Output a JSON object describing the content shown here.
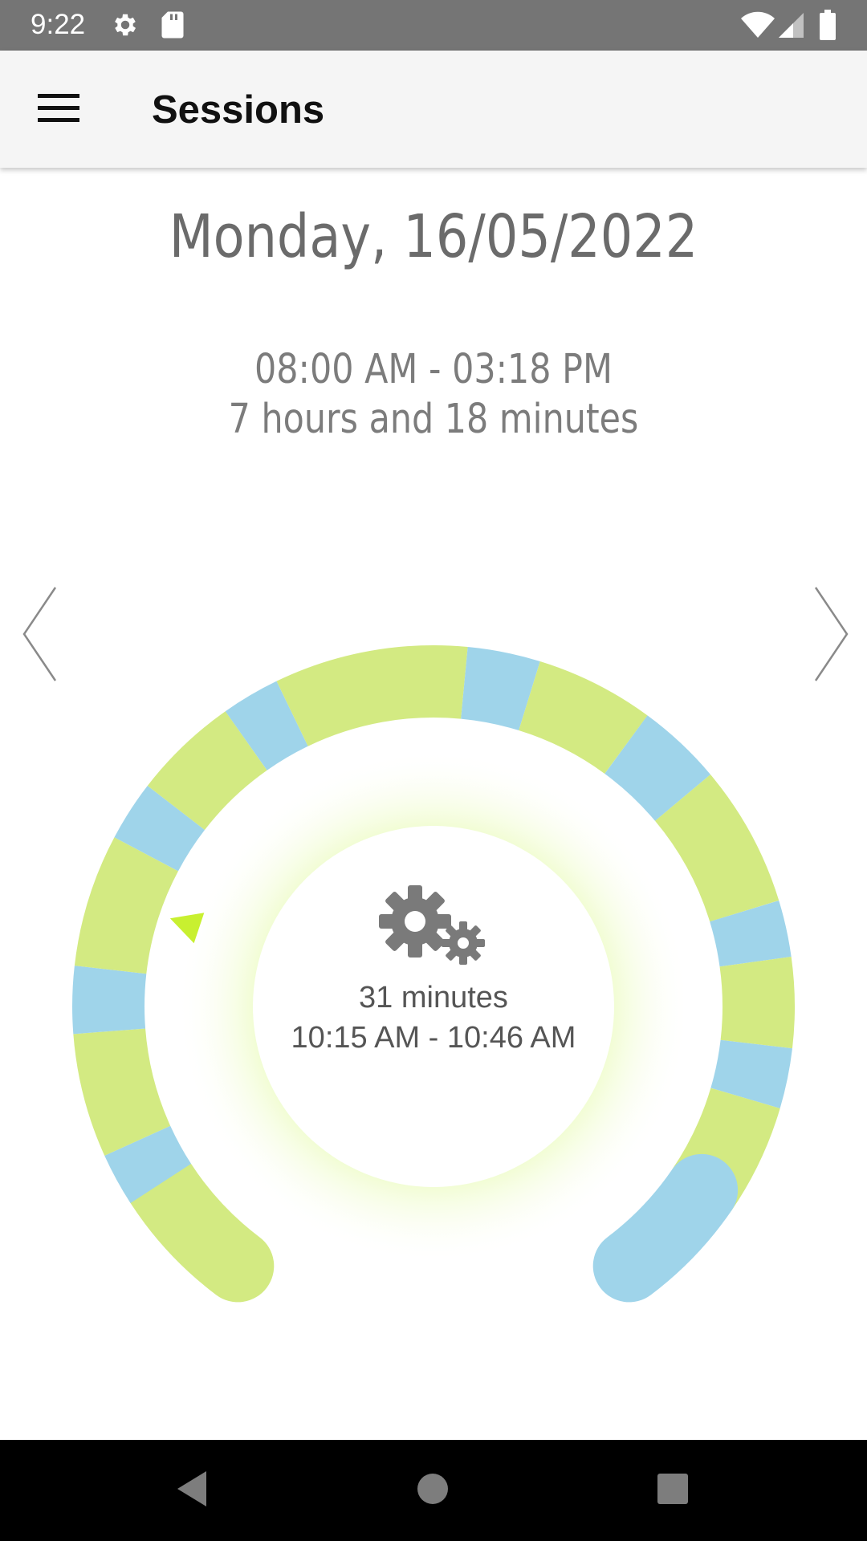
{
  "status_bar": {
    "time": "9:22",
    "icons": [
      "settings-icon",
      "sd-card-icon",
      "wifi-icon",
      "signal-icon",
      "battery-icon"
    ]
  },
  "app_bar": {
    "title": "Sessions",
    "menu_icon": "hamburger-menu-icon"
  },
  "day": {
    "date": "Monday, 16/05/2022",
    "time_range": "08:00 AM - 03:18 PM",
    "total_duration": "7 hours and 18 minutes"
  },
  "selected_session": {
    "icon": "gears-icon",
    "duration": "31 minutes",
    "time_range": "10:15 AM - 10:46 AM"
  },
  "colors": {
    "active": "#d3ea82",
    "break": "#9fd4ea",
    "marker": "#c8f030",
    "glow": "#eefcc8",
    "text": "#6b6b6b"
  },
  "timeline_segments": [
    {
      "type": "active",
      "from": 0.0,
      "to": 0.07
    },
    {
      "type": "break",
      "from": 0.07,
      "to": 0.1
    },
    {
      "type": "active",
      "from": 0.1,
      "to": 0.17
    },
    {
      "type": "break",
      "from": 0.17,
      "to": 0.208
    },
    {
      "type": "active",
      "from": 0.208,
      "to": 0.283
    },
    {
      "type": "break",
      "from": 0.283,
      "to": 0.317
    },
    {
      "type": "active",
      "from": 0.317,
      "to": 0.377
    },
    {
      "type": "break",
      "from": 0.377,
      "to": 0.41
    },
    {
      "type": "active",
      "from": 0.41,
      "to": 0.519
    },
    {
      "type": "break",
      "from": 0.519,
      "to": 0.56
    },
    {
      "type": "active",
      "from": 0.56,
      "to": 0.627
    },
    {
      "type": "break",
      "from": 0.627,
      "to": 0.675
    },
    {
      "type": "active",
      "from": 0.675,
      "to": 0.755
    },
    {
      "type": "break",
      "from": 0.755,
      "to": 0.787
    },
    {
      "type": "active",
      "from": 0.787,
      "to": 0.838
    },
    {
      "type": "break",
      "from": 0.838,
      "to": 0.872
    },
    {
      "type": "active",
      "from": 0.872,
      "to": 0.935
    },
    {
      "type": "break",
      "from": 0.935,
      "to": 1.0
    }
  ],
  "selected_marker": 0.25
}
